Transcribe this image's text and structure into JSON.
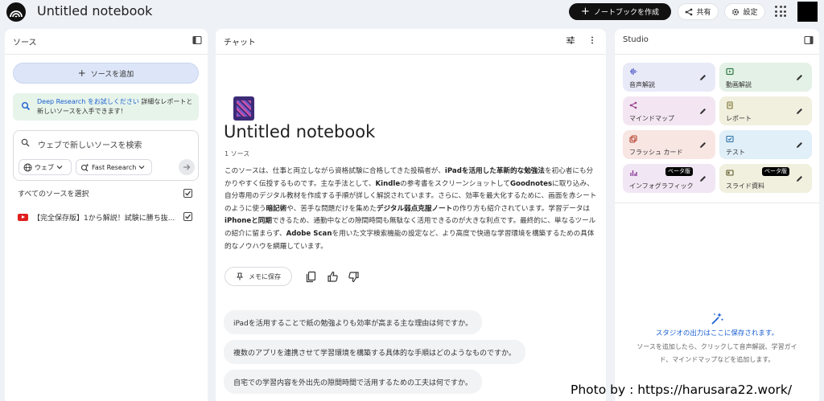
{
  "header": {
    "title": "Untitled notebook",
    "create_label": "ノートブックを作成",
    "share_label": "共有",
    "settings_label": "設定"
  },
  "sources": {
    "title": "ソース",
    "add_label": "ソースを追加",
    "deep_research": {
      "link": "Deep Research をお試しください",
      "text_line1": "詳細なレポートと",
      "text_line2": "新しいソースを入手できます！"
    },
    "search_placeholder": "ウェブで新しいソースを検索",
    "chip_web": "ウェブ",
    "chip_fast": "Fast Research",
    "select_all": "すべてのソースを選択",
    "items": [
      {
        "label": "【完全保存版】1から解説！試験に勝ち抜..."
      }
    ]
  },
  "chat": {
    "title": "チャット",
    "notebook_title": "Untitled notebook",
    "source_count": "1 ソース",
    "summary": [
      {
        "t": "このソースは、仕事と両立しながら資格試験に合格してきた投稿者が、"
      },
      {
        "t": "iPadを活用した革新的な勉強法",
        "b": true
      },
      {
        "t": "を初心者にも分かりやすく伝授するものです。主な手法として、"
      },
      {
        "t": "Kindle",
        "b": true
      },
      {
        "t": "の参考書をスクリーンショットして"
      },
      {
        "t": "Goodnotes",
        "b": true
      },
      {
        "t": "に取り込み、自分専用のデジタル教材を作成する手順が詳しく解説されています。さらに、効率を最大化するために、画面を赤シートのように使う"
      },
      {
        "t": "暗記術",
        "b": true
      },
      {
        "t": "や、苦手な問題だけを集めた"
      },
      {
        "t": "デジタル弱点克服ノート",
        "b": true
      },
      {
        "t": "の作り方も紹介されています。学習データは"
      },
      {
        "t": "iPhoneと同期",
        "b": true
      },
      {
        "t": "できるため、通勤中などの隙間時間も無駄なく活用できるのが大きな利点です。最終的に、単なるツールの紹介に留まらず、"
      },
      {
        "t": "Adobe Scan",
        "b": true
      },
      {
        "t": "を用いた文字検索機能の設定など、より高度で快適な学習環境を構築するための具体的なノウハウを網羅しています。"
      }
    ],
    "memo_label": "メモに保存",
    "suggestions": [
      "iPadを活用することで紙の勉強よりも効率が高まる主な理由は何ですか。",
      "複数のアプリを連携させて学習環境を構築する具体的な手順はどのようなものですか。",
      "自宅での学習内容を外出先の隙間時間で活用するための工夫は何ですか。"
    ]
  },
  "studio": {
    "title": "Studio",
    "tiles": [
      {
        "label": "音声解説",
        "icon": "audio-wave-icon",
        "bg": "#e8eaf8",
        "accent": "#4a55c8"
      },
      {
        "label": "動画解説",
        "icon": "video-icon",
        "bg": "#e3f1e6",
        "accent": "#2f7a45"
      },
      {
        "label": "マインドマップ",
        "icon": "mindmap-icon",
        "bg": "#f3e6f2",
        "accent": "#9a3f8e"
      },
      {
        "label": "レポート",
        "icon": "report-icon",
        "bg": "#f1efde",
        "accent": "#7a7330"
      },
      {
        "label": "フラッシュ カード",
        "icon": "flashcard-icon",
        "bg": "#f8e6e3",
        "accent": "#b8402e"
      },
      {
        "label": "テスト",
        "icon": "quiz-icon",
        "bg": "#e0eff8",
        "accent": "#2a70a8"
      },
      {
        "label": "インフォグラフィック",
        "icon": "infographic-icon",
        "bg": "#f1e6f3",
        "accent": "#8a3f9a",
        "beta": "ベータ版"
      },
      {
        "label": "スライド資料",
        "icon": "slides-icon",
        "bg": "#f1efde",
        "accent": "#5a5a2a",
        "beta": "ベータ版"
      }
    ],
    "empty_title": "スタジオの出力はここに保存されます。",
    "empty_desc_line1": "ソースを追加したら、クリックして音声解説、学習ガイ",
    "empty_desc_line2": "ド、マインドマップなどを追加します。"
  },
  "credit": "Photo by : https://harusara22.work/"
}
